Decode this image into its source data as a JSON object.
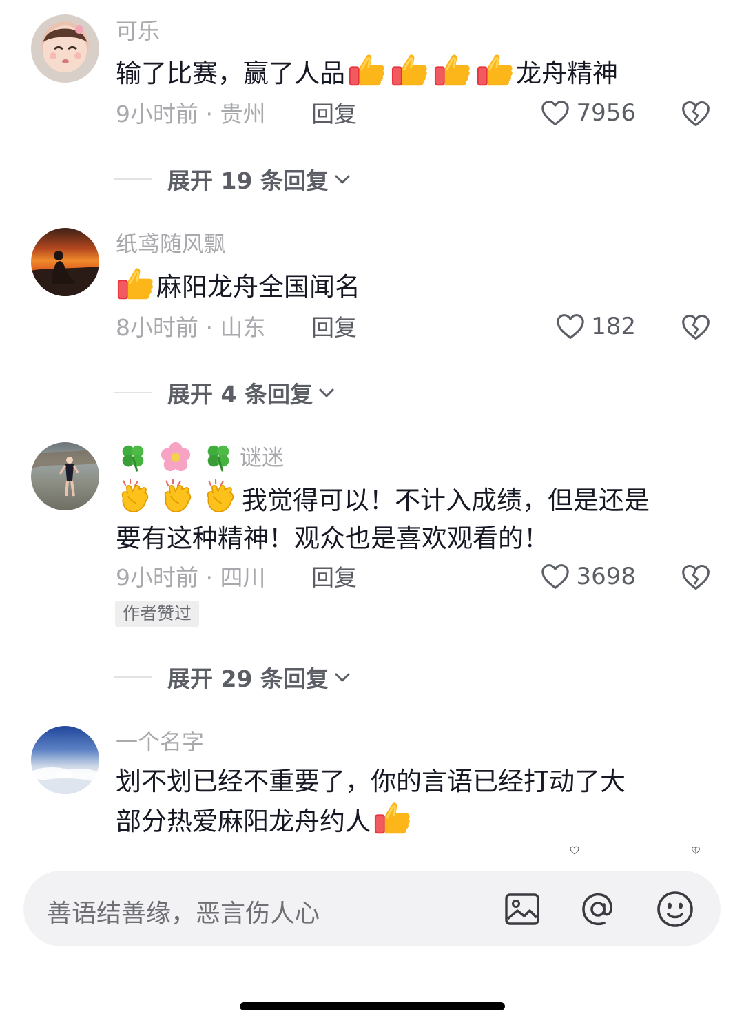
{
  "comments": [
    {
      "username": "可乐",
      "text_prefix": "输了比赛，赢了人品",
      "text_suffix": "龙舟精神",
      "time_location": "9小时前 · 贵州",
      "reply_label": "回复",
      "likes": "7956",
      "expand_label": "展开 19 条回复"
    },
    {
      "username": "纸鸢随风飘",
      "text_suffix": "麻阳龙舟全国闻名",
      "time_location": "8小时前 · 山东",
      "reply_label": "回复",
      "likes": "182",
      "expand_label": "展开 4 条回复"
    },
    {
      "username": "谜迷",
      "text_line1": "我觉得可以！不计入成绩，但是还是",
      "text_line2": "要有这种精神！观众也是喜欢观看的！",
      "time_location": "9小时前 · 四川",
      "reply_label": "回复",
      "likes": "3698",
      "badge": "作者赞过",
      "expand_label": "展开 29 条回复"
    },
    {
      "username": "一个名字",
      "text_line1": "划不划已经不重要了，你的言语已经打动了大",
      "text_line2": "部分热爱麻阳龙舟约人"
    }
  ],
  "input": {
    "placeholder": "善语结善缘，恶言伤人心"
  },
  "icons": {
    "like": "heart-outline-icon",
    "dislike": "broken-heart-icon",
    "image": "image-icon",
    "mention": "at-icon",
    "emoji": "smiley-icon"
  },
  "colors": {
    "primary_text": "#161823",
    "secondary_text": "#a8a9ad",
    "action_text": "#5c5e66",
    "input_bg": "#f2f2f4"
  }
}
